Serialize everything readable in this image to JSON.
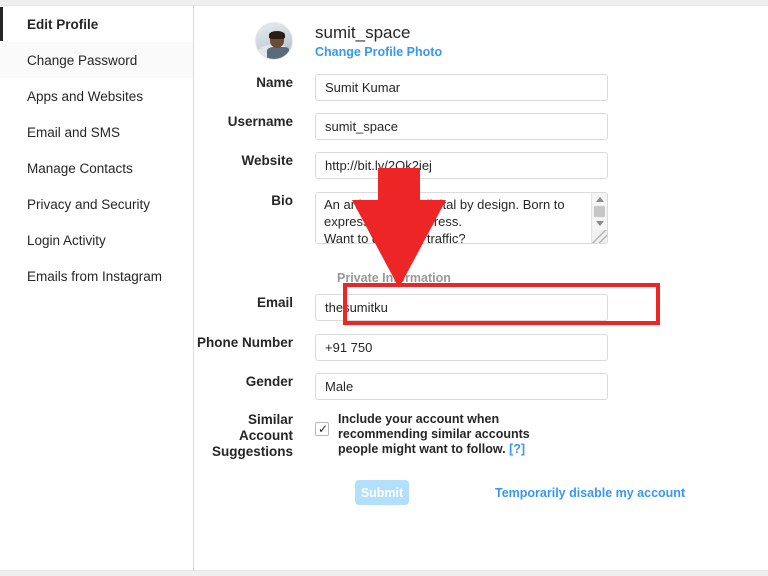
{
  "sidebar": {
    "items": [
      {
        "label": "Edit Profile",
        "state": "active"
      },
      {
        "label": "Change Password",
        "state": "hovered"
      },
      {
        "label": "Apps and Websites",
        "state": "normal"
      },
      {
        "label": "Email and SMS",
        "state": "normal"
      },
      {
        "label": "Manage Contacts",
        "state": "normal"
      },
      {
        "label": "Privacy and Security",
        "state": "normal"
      },
      {
        "label": "Login Activity",
        "state": "normal"
      },
      {
        "label": "Emails from Instagram",
        "state": "normal"
      }
    ]
  },
  "profile": {
    "username": "sumit_space",
    "change_photo_label": "Change Profile Photo",
    "avatar_name": "user-avatar"
  },
  "form": {
    "name": {
      "label": "Name",
      "value": "Sumit Kumar"
    },
    "username": {
      "label": "Username",
      "value": "sumit_space"
    },
    "website": {
      "label": "Website",
      "value": "http://bit.ly/2Ok2iej"
    },
    "bio": {
      "label": "Bio",
      "value": "An artist at birth, digital by design. Born to express, not to impress.\nWant to get more traffic?"
    },
    "private_information_label": "Private Information",
    "email": {
      "label": "Email",
      "value": "thesumitku"
    },
    "phone": {
      "label": "Phone Number",
      "value": "+91 750"
    },
    "gender": {
      "label": "Gender",
      "value": "Male"
    },
    "similar_accounts": {
      "label": "Similar Account Suggestions",
      "checkbox_checked": true,
      "text_line1": "Include your account when",
      "text_line2": "recommending similar accounts",
      "text_line3": "people might want to follow.",
      "help_label": "[?]"
    },
    "submit_label": "Submit",
    "disable_account_label": "Temporarily disable my account"
  },
  "annotations": {
    "arrow_color": "#ee2526",
    "highlight_color": "#ee2526",
    "arrow_name": "red-down-arrow",
    "highlight_target": "email-field"
  },
  "colors": {
    "accent_blue": "#3897f0",
    "submit_disabled": "#b2dffc",
    "border_gray": "#dbdbdb",
    "text_dark": "#262626",
    "muted_gray": "#999999"
  }
}
